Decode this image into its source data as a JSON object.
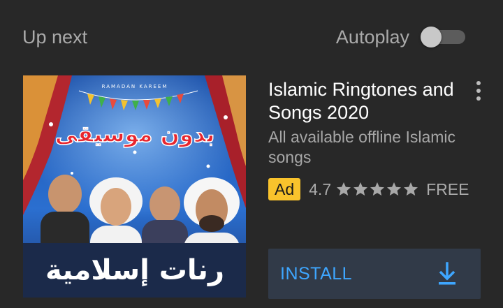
{
  "header": {
    "up_next_label": "Up next",
    "autoplay_label": "Autoplay",
    "autoplay_on": false
  },
  "ad": {
    "thumbnail": {
      "top_text": "RAMADAN KAREEM",
      "headline_ar": "بدون موسيقى",
      "footer_ar": "رنات إسلامية"
    },
    "title": "Islamic Ringtones and Songs 2020",
    "description": "All available offline Islamic songs",
    "badge": "Ad",
    "rating": "4.7",
    "stars": 5,
    "price": "FREE",
    "install_label": "INSTALL"
  },
  "colors": {
    "background": "#282828",
    "accent": "#3ea6ff",
    "ad_badge": "#f9c32c",
    "install_bg": "#313a48"
  },
  "icons": {
    "more": "more-vert-icon",
    "download": "download-icon",
    "star": "star-icon"
  }
}
